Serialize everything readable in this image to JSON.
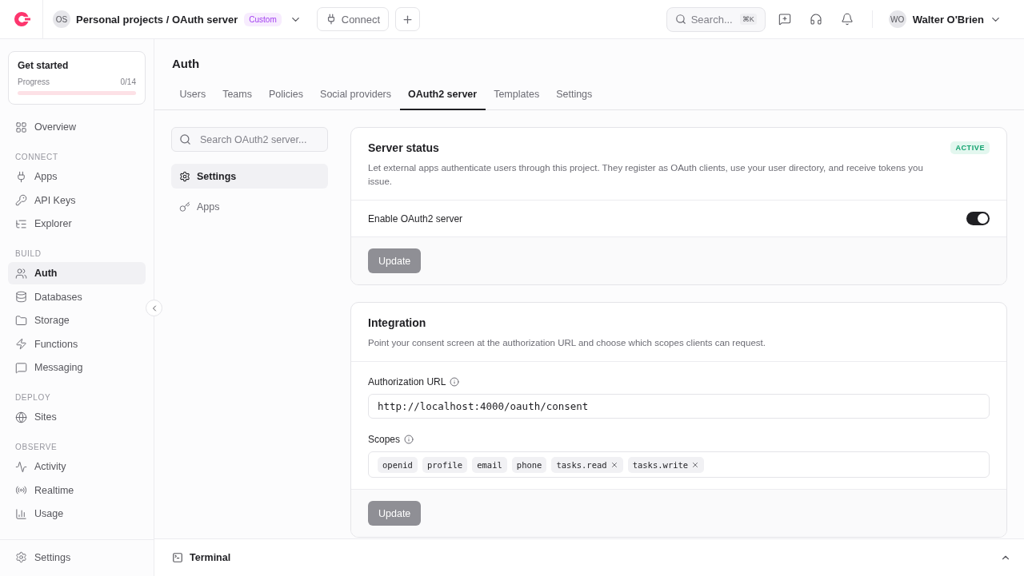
{
  "topbar": {
    "project_initials": "OS",
    "project": "Personal projects / OAuth server",
    "plan_badge": "Custom",
    "connect": "Connect",
    "search": {
      "placeholder": "Search...",
      "shortcut": "⌘K"
    },
    "user_initials": "WO",
    "user": "Walter O'Brien"
  },
  "get_started": {
    "title": "Get started",
    "progress_label": "Progress",
    "progress_count": "0/14",
    "level": 0
  },
  "sidebar": {
    "sections": [
      {
        "items": [
          {
            "label": "Overview",
            "selected": false
          }
        ]
      },
      {
        "heading": "CONNECT",
        "items": [
          {
            "label": "Apps",
            "selected": false
          },
          {
            "label": "API Keys",
            "selected": false
          },
          {
            "label": "Explorer",
            "selected": false
          }
        ]
      },
      {
        "heading": "BUILD",
        "items": [
          {
            "label": "Auth",
            "selected": true
          },
          {
            "label": "Databases",
            "selected": false
          },
          {
            "label": "Storage",
            "selected": false
          },
          {
            "label": "Functions",
            "selected": false
          },
          {
            "label": "Messaging",
            "selected": false
          }
        ]
      },
      {
        "heading": "DEPLOY",
        "items": [
          {
            "label": "Sites",
            "selected": false
          }
        ]
      },
      {
        "heading": "OBSERVE",
        "items": [
          {
            "label": "Activity",
            "selected": false
          },
          {
            "label": "Realtime",
            "selected": false
          },
          {
            "label": "Usage",
            "selected": false
          }
        ]
      }
    ],
    "footer": {
      "label": "Settings"
    }
  },
  "page": {
    "title": "Auth",
    "tabs": [
      {
        "label": "Users",
        "selected": false
      },
      {
        "label": "Teams",
        "selected": false
      },
      {
        "label": "Policies",
        "selected": false
      },
      {
        "label": "Social providers",
        "selected": false
      },
      {
        "label": "OAuth2 server",
        "selected": true
      },
      {
        "label": "Templates",
        "selected": false
      },
      {
        "label": "Settings",
        "selected": false
      }
    ]
  },
  "subnav": {
    "search_placeholder": "Search OAuth2 server...",
    "items": [
      {
        "label": "Settings",
        "selected": true
      },
      {
        "label": "Apps",
        "selected": false
      }
    ]
  },
  "server_status": {
    "title": "Server status",
    "badge": "ACTIVE",
    "description": "Let external apps authenticate users through this project. They register as OAuth clients, use your user directory, and receive tokens you issue.",
    "toggle_label": "Enable OAuth2 server",
    "on": true,
    "button": "Update",
    "button_disabled": true
  },
  "integration": {
    "title": "Integration",
    "description": "Point your consent screen at the authorization URL and choose which scopes clients can request.",
    "url_label": "Authorization URL",
    "url_value": "http://localhost:4000/oauth/consent",
    "scopes_label": "Scopes",
    "scopes": [
      {
        "label": "openid",
        "removable": false
      },
      {
        "label": "profile",
        "removable": false
      },
      {
        "label": "email",
        "removable": false
      },
      {
        "label": "phone",
        "removable": false
      },
      {
        "label": "tasks.read",
        "removable": true
      },
      {
        "label": "tasks.write",
        "removable": true
      }
    ],
    "button": "Update",
    "button_disabled": true
  },
  "terminal": {
    "label": "Terminal",
    "expanded": false
  }
}
